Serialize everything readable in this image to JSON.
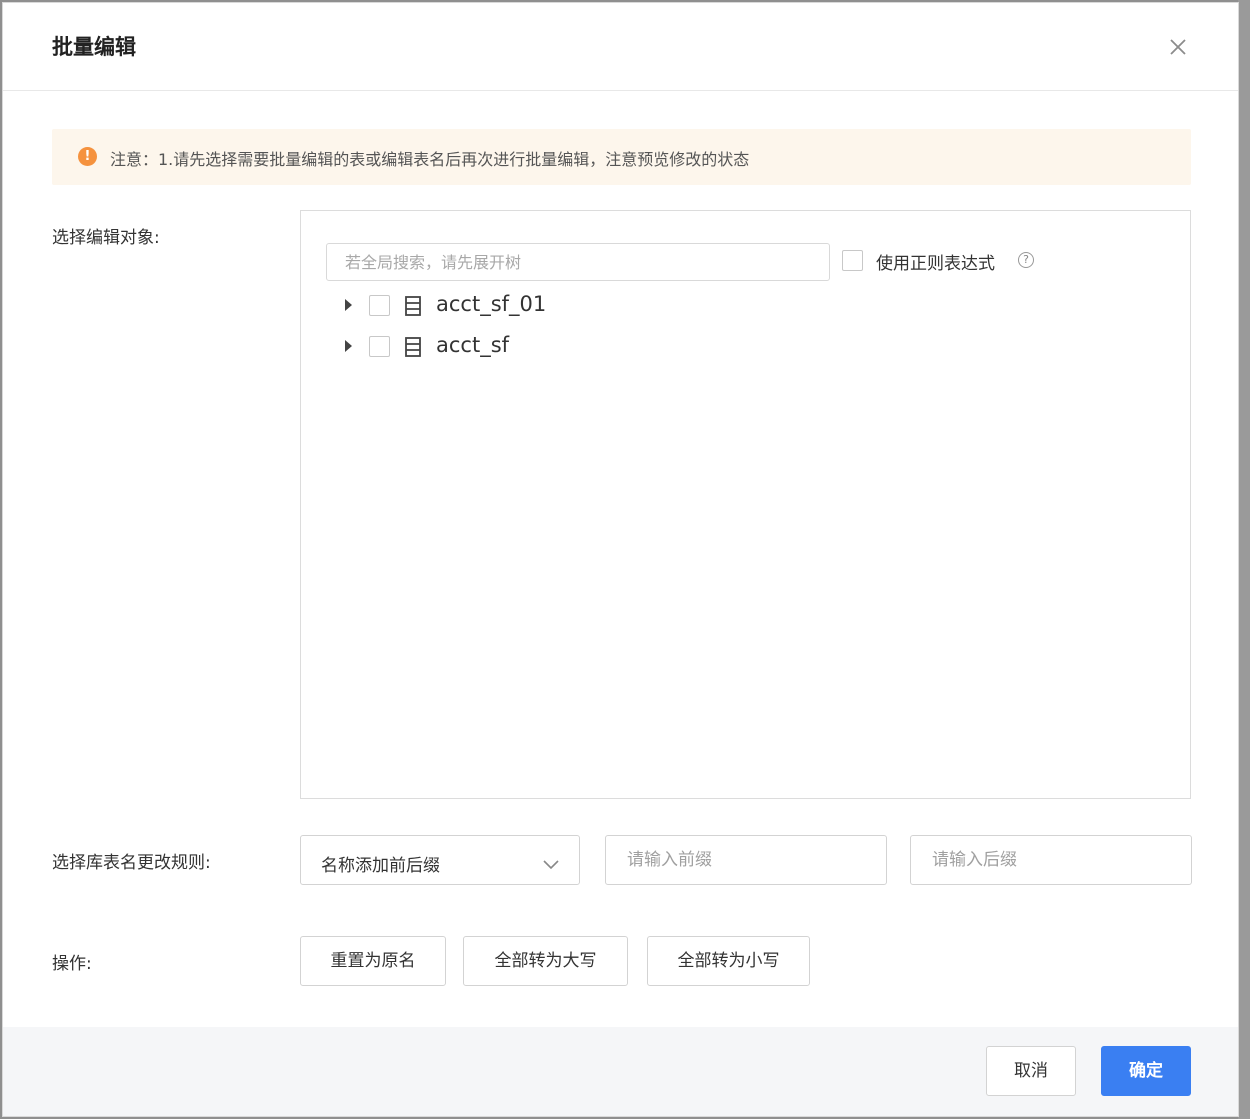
{
  "dialog": {
    "title": "批量编辑"
  },
  "notice": {
    "icon": "warning-icon",
    "text": "注意：1.请先选择需要批量编辑的表或编辑表名后再次进行批量编辑，注意预览修改的状态",
    "color": "#f5923e"
  },
  "labels": {
    "select_target": "选择编辑对象:",
    "rename_rule": "选择库表名更改规则:",
    "operation": "操作:"
  },
  "tree": {
    "search_placeholder": "若全局搜索，请先展开树",
    "regex_label": "使用正则表达式",
    "regex_checked": false,
    "nodes": [
      {
        "label": "acct_sf_01",
        "icon": "table-icon",
        "checked": false,
        "expanded": false
      },
      {
        "label": "acct_sf",
        "icon": "table-icon",
        "checked": false,
        "expanded": false
      }
    ]
  },
  "rule": {
    "selected": "名称添加前后缀",
    "prefix_placeholder": "请输入前缀",
    "suffix_placeholder": "请输入后缀"
  },
  "operations": {
    "reset": "重置为原名",
    "upper": "全部转为大写",
    "lower": "全部转为小写"
  },
  "footer": {
    "cancel": "取消",
    "confirm": "确定",
    "primary_color": "#3a7ff2"
  }
}
